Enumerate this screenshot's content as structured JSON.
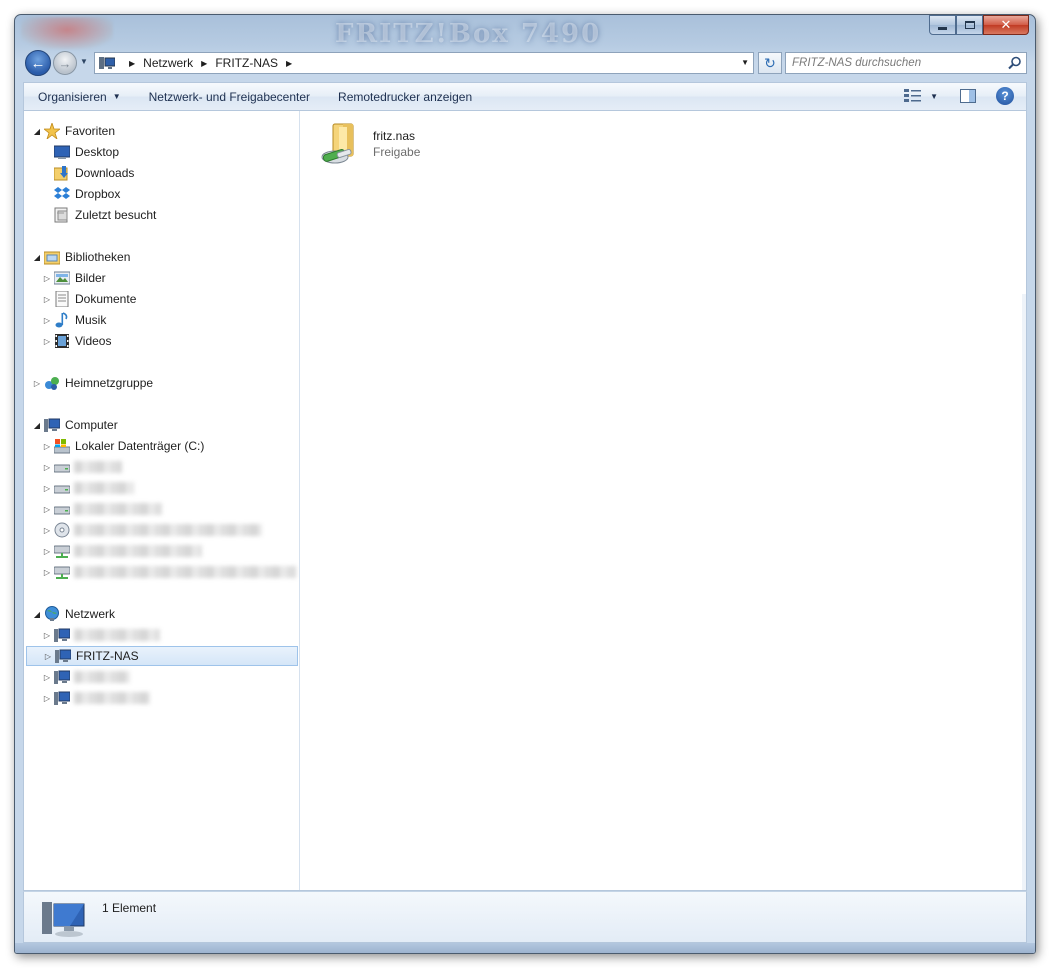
{
  "window": {
    "title_logo": "FRITZ!Box 7490",
    "minimize_label": "minimize",
    "maximize_label": "maximize",
    "close_label": "✕"
  },
  "navigation": {
    "back_icon": "back-arrow-icon",
    "forward_icon": "forward-arrow-icon",
    "breadcrumbs": [
      "Netzwerk",
      "FRITZ-NAS"
    ],
    "search_placeholder": "FRITZ-NAS durchsuchen"
  },
  "toolbar": {
    "organize_label": "Organisieren",
    "network_center_label": "Netzwerk- und Freigabecenter",
    "remote_printer_label": "Remotedrucker anzeigen"
  },
  "sidebar": {
    "favorites": {
      "label": "Favoriten",
      "items": [
        {
          "label": "Desktop",
          "icon": "desktop-icon"
        },
        {
          "label": "Downloads",
          "icon": "downloads-folder-icon"
        },
        {
          "label": "Dropbox",
          "icon": "dropbox-icon"
        },
        {
          "label": "Zuletzt besucht",
          "icon": "recent-places-icon"
        }
      ]
    },
    "libraries": {
      "label": "Bibliotheken",
      "items": [
        {
          "label": "Bilder",
          "icon": "pictures-library-icon"
        },
        {
          "label": "Dokumente",
          "icon": "documents-library-icon"
        },
        {
          "label": "Musik",
          "icon": "music-library-icon"
        },
        {
          "label": "Videos",
          "icon": "videos-library-icon"
        }
      ]
    },
    "homegroup": {
      "label": "Heimnetzgruppe"
    },
    "computer": {
      "label": "Computer",
      "items": [
        {
          "label": "Lokaler Datenträger (C:)",
          "icon": "local-disk-icon"
        }
      ]
    },
    "network": {
      "label": "Netzwerk",
      "items": [
        {
          "label": "FRITZ-NAS",
          "icon": "network-computer-icon",
          "selected": true
        }
      ]
    }
  },
  "files": [
    {
      "name": "fritz.nas",
      "type": "Freigabe",
      "icon": "shared-folder-icon"
    }
  ],
  "status": {
    "item_count": "1 Element"
  },
  "colors": {
    "accent": "#2a5ba9",
    "selection": "#d5e6f8",
    "close_button": "#c13b24"
  }
}
